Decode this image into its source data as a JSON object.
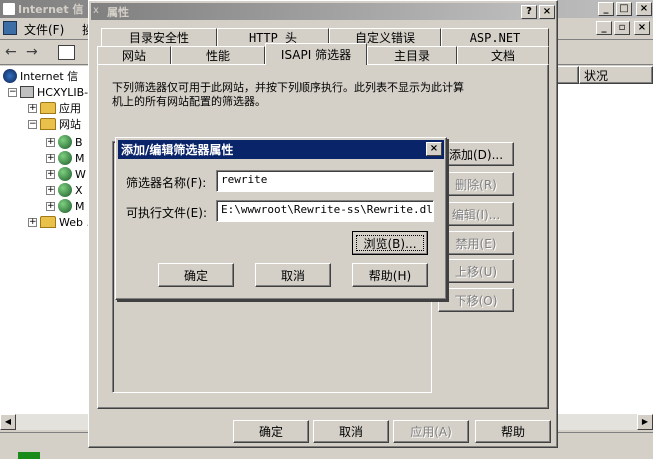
{
  "main_window": {
    "title": "Internet 信",
    "menu": {
      "file": "文件(F)",
      "action": "操"
    },
    "tree": {
      "root": "Internet 信",
      "server": "HCXYLIB-",
      "app_pools": "应用",
      "websites": "网站",
      "site_b": "B",
      "site_m1": "M",
      "site_w": "W",
      "site_x": "X",
      "site_m2": "M",
      "web_ext": "Web ."
    },
    "list_header": {
      "status": "状况"
    }
  },
  "properties_dialog": {
    "title": "属性",
    "tabs_row1": [
      "目录安全性",
      "HTTP 头",
      "自定义错误",
      "ASP.NET"
    ],
    "tabs_row2": [
      "网站",
      "性能",
      "ISAPI 筛选器",
      "主目录",
      "文档"
    ],
    "active_tab": "ISAPI 筛选器",
    "description_line1": "下列筛选器仅可用于此网站，并按下列顺序执行。此列表不显示为此计算",
    "description_line2": "机上的所有网站配置的筛选器。",
    "side_buttons": {
      "add": "添加(D)...",
      "remove": "删除(R)",
      "edit": "编辑(I)...",
      "disable": "禁用(E)",
      "move_up": "上移(U)",
      "move_down": "下移(O)"
    },
    "bottom_buttons": {
      "ok": "确定",
      "cancel": "取消",
      "apply": "应用(A)",
      "help": "帮助"
    }
  },
  "filter_dialog": {
    "title": "添加/编辑筛选器属性",
    "name_label": "筛选器名称(F):",
    "name_value": "rewrite",
    "exe_label": "可执行文件(E):",
    "exe_value": "E:\\wwwroot\\Rewrite-ss\\Rewrite.dll",
    "browse": "浏览(B)...",
    "ok": "确定",
    "cancel": "取消",
    "help": "帮助(H)"
  },
  "colors": {
    "active_title": "#0a246a",
    "face": "#d4d0c8"
  }
}
